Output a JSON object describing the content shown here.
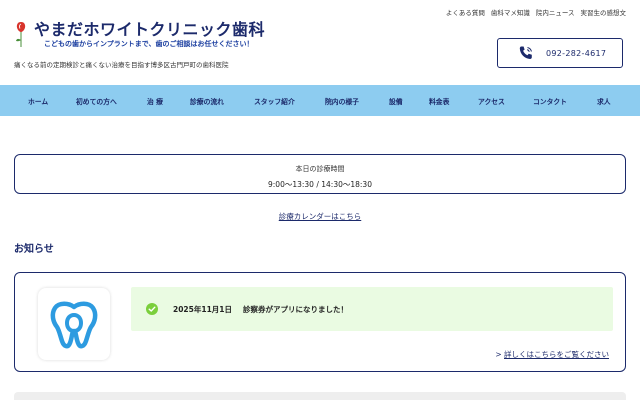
{
  "header": {
    "clinic_name": "やまだホワイトクリニック歯科",
    "subtitle": "こどもの歯からインプラントまで、歯のご相談はお任せください！",
    "tagline": "痛くなる前の定期検診と痛くない治療を目指す博多区古門戸町の歯科医院",
    "top_links": [
      "よくある質問",
      "歯科マメ知識",
      "院内ニュース",
      "実習生の感想文"
    ],
    "phone": "092-282-4617"
  },
  "nav": {
    "items": [
      "ホーム",
      "初めての方へ",
      "治 療",
      "診療の流れ",
      "スタッフ紹介",
      "院内の様子",
      "設備",
      "料金表",
      "アクセス",
      "コンタクト",
      "求人"
    ]
  },
  "hours": {
    "title": "本日の診療時間",
    "time": "9:00〜13:30 / 14:30〜18:30"
  },
  "calendar_link": "診療カレンダーはこちら",
  "news": {
    "heading": "お知らせ",
    "items": [
      {
        "date": "2025年11月1日",
        "text": "診察券がアプリになりました！"
      }
    ],
    "more_prefix": ">",
    "more_label": "詳しくはこちらをご覧ください"
  },
  "colors": {
    "brand_navy": "#1c2a6b",
    "nav_bg": "#8dccf0",
    "news_bg": "#eafbe2",
    "check_green": "#7bcf3c",
    "tooth_blue": "#2d9be0",
    "logo_red": "#d8342c"
  },
  "icons": {
    "logo": "tooth-flower-logo-icon",
    "phone": "phone-icon",
    "check": "check-circle-icon",
    "app": "tooth-app-icon"
  }
}
